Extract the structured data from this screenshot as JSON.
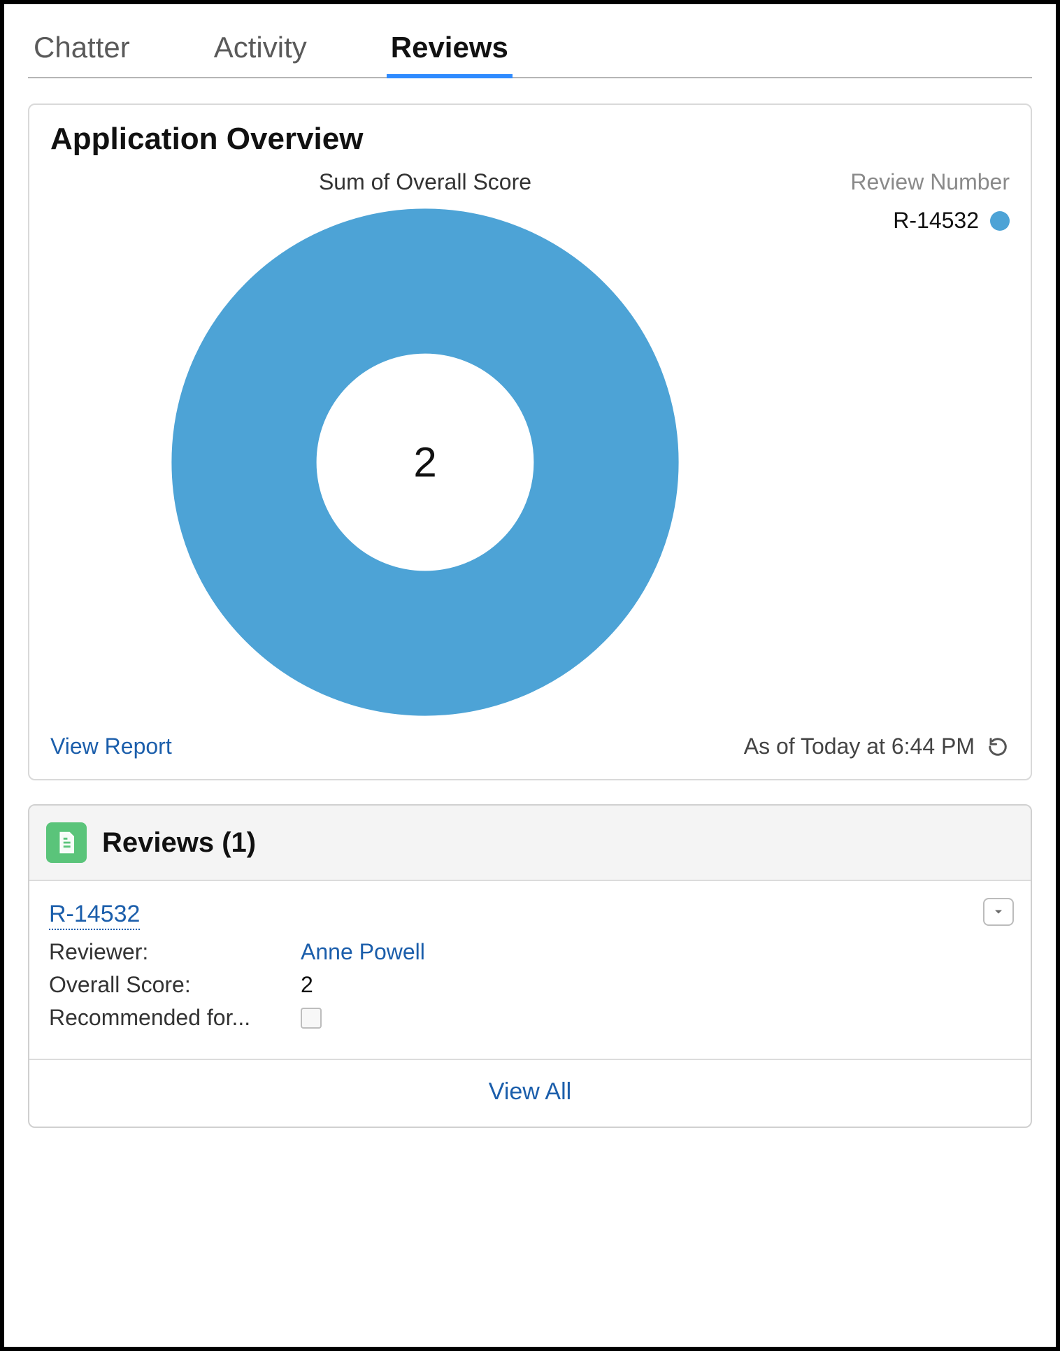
{
  "tabs": {
    "chatter": "Chatter",
    "activity": "Activity",
    "reviews": "Reviews"
  },
  "overview": {
    "title": "Application Overview",
    "chart_label": "Sum of Overall Score",
    "legend_header": "Review Number",
    "legend_item": "R-14532",
    "center_value": "2",
    "view_report": "View Report",
    "asof": "As of Today at 6:44 PM"
  },
  "related": {
    "title": "Reviews (1)",
    "record_link": "R-14532",
    "fields": {
      "reviewer_label": "Reviewer:",
      "reviewer_value": "Anne Powell",
      "score_label": "Overall Score:",
      "score_value": "2",
      "recommended_label": "Recommended for..."
    },
    "view_all": "View All"
  },
  "colors": {
    "accent": "#4da3d6",
    "link": "#1b5eab"
  },
  "chart_data": {
    "type": "pie",
    "title": "Sum of Overall Score",
    "categories": [
      "R-14532"
    ],
    "values": [
      2
    ],
    "total_label": "2",
    "legend_title": "Review Number"
  }
}
